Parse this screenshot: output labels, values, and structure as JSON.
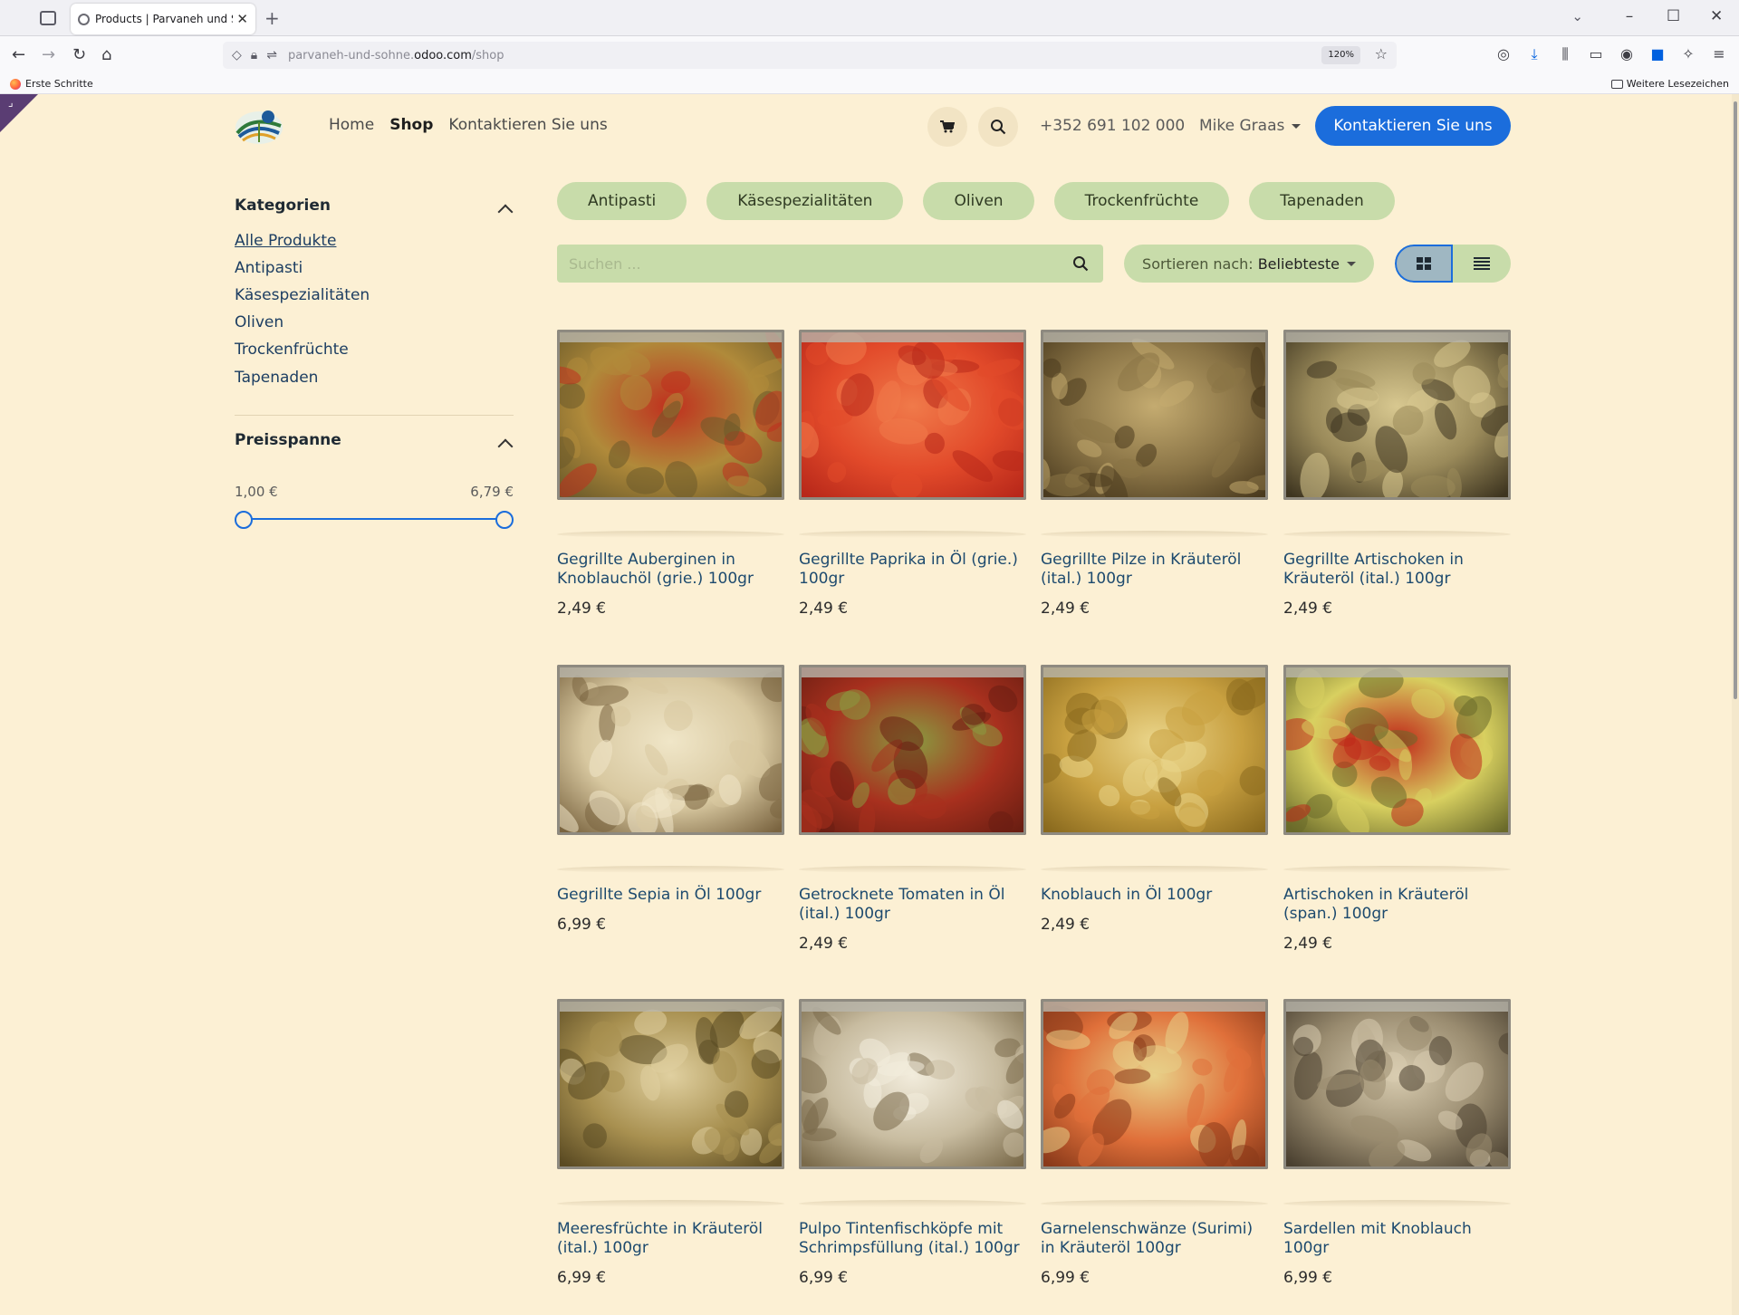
{
  "browser": {
    "tab_title": "Products | Parvaneh und Söhne",
    "url_prefix": "parvaneh-und-sohne.",
    "url_host": "odoo.com",
    "url_path": "/shop",
    "zoom": "120%",
    "bookmark_left": "Erste Schritte",
    "bookmark_right": "Weitere Lesezeichen"
  },
  "header": {
    "nav": [
      "Home",
      "Shop",
      "Kontaktieren Sie uns"
    ],
    "phone": "+352 691 102 000",
    "user": "Mike Graas",
    "cta": "Kontaktieren Sie uns"
  },
  "sidebar": {
    "categories_title": "Kategorien",
    "categories": [
      "Alle Produkte",
      "Antipasti",
      "Käsespezialitäten",
      "Oliven",
      "Trockenfrüchte",
      "Tapenaden"
    ],
    "price_title": "Preisspanne",
    "price_min": "1,00 €",
    "price_max": "6,79 €"
  },
  "filters": {
    "chips": [
      "Antipasti",
      "Käsespezialitäten",
      "Oliven",
      "Trockenfrüchte",
      "Tapenaden"
    ],
    "search_placeholder": "Suchen ...",
    "sort_label": "Sortieren nach:",
    "sort_value": "Beliebteste"
  },
  "products": [
    {
      "name": "Gegrillte Auberginen in Knoblauchöl (grie.) 100gr",
      "price": "2,49 €",
      "c1": "#6b5a2a",
      "c2": "#b08a3a",
      "c3": "#c0301e"
    },
    {
      "name": "Gegrillte Paprika in Öl (grie.) 100gr",
      "price": "2,49 €",
      "c1": "#b8281a",
      "c2": "#e24a2a",
      "c3": "#f07a4a"
    },
    {
      "name": "Gegrillte Pilze in Kräuteröl (ital.) 100gr",
      "price": "2,49 €",
      "c1": "#4a3a1e",
      "c2": "#8a7446",
      "c3": "#c4ab70"
    },
    {
      "name": "Gegrillte Artischoken in Kräuteröl (ital.) 100gr",
      "price": "2,49 €",
      "c1": "#3e3520",
      "c2": "#9a8a5a",
      "c3": "#d8c890"
    },
    {
      "name": "Gegrillte Sepia in Öl 100gr",
      "price": "6,99 €",
      "c1": "#7a6440",
      "c2": "#d8c8a0",
      "c3": "#f0e6c8"
    },
    {
      "name": "Getrocknete Tomaten in Öl (ital.) 100gr",
      "price": "2,49 €",
      "c1": "#6a1e12",
      "c2": "#a8301e",
      "c3": "#8a9a40"
    },
    {
      "name": "Knoblauch in Öl 100gr",
      "price": "2,49 €",
      "c1": "#8a6a1e",
      "c2": "#c8a040",
      "c3": "#ead58a"
    },
    {
      "name": "Artischoken in Kräuteröl (span.) 100gr",
      "price": "2,49 €",
      "c1": "#6a6a2a",
      "c2": "#d8d060",
      "c3": "#c0281a"
    },
    {
      "name": "Meeresfrüchte in Kräuteröl (ital.) 100gr",
      "price": "6,99 €",
      "c1": "#5a4a22",
      "c2": "#a89050",
      "c3": "#e0d0a0"
    },
    {
      "name": "Pulpo Tintenfischköpfe mit Schrimpsfüllung (ital.) 100gr",
      "price": "6,99 €",
      "c1": "#7a6a4a",
      "c2": "#c8bca0",
      "c3": "#f2ecdc"
    },
    {
      "name": "Garnelenschwänze (Surimi) in Kräuteröl 100gr",
      "price": "6,99 €",
      "c1": "#8a3a1a",
      "c2": "#e0703a",
      "c3": "#e8d088"
    },
    {
      "name": "Sardellen mit Knoblauch 100gr",
      "price": "6,99 €",
      "c1": "#4a4030",
      "c2": "#9a8c70",
      "c3": "#d8ccb0"
    }
  ]
}
